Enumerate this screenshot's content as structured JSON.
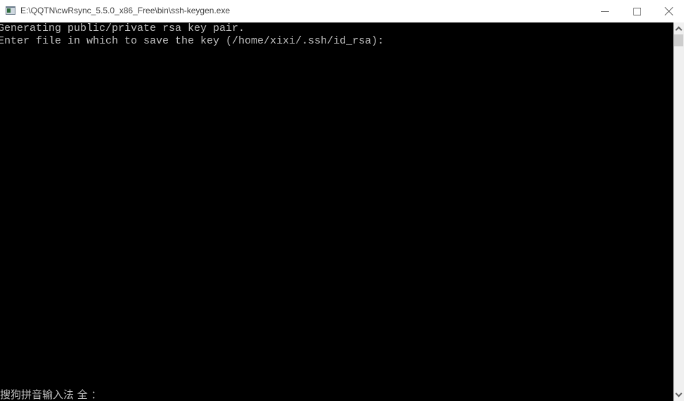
{
  "window": {
    "title": "E:\\QQTN\\cwRsync_5.5.0_x86_Free\\bin\\ssh-keygen.exe",
    "controls": {
      "minimize": "minimize",
      "maximize": "maximize",
      "close": "close"
    }
  },
  "console": {
    "lines": [
      "Generating public/private rsa key pair.",
      "Enter file in which to save the key (/home/xixi/.ssh/id_rsa):"
    ],
    "ime_status": "搜狗拼音输入法 全 ："
  },
  "scrollbar": {
    "position": 0
  }
}
